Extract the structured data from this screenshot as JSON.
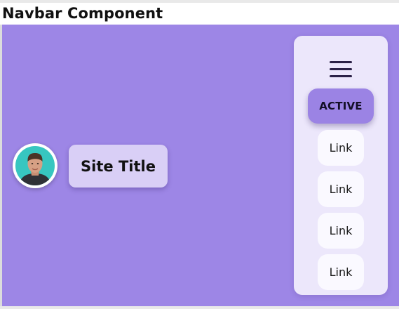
{
  "page": {
    "heading": "Navbar Component"
  },
  "navbar": {
    "site_title": "Site Title",
    "avatar_icon": "user-avatar-icon",
    "menu_icon": "hamburger-menu-icon",
    "active_link": "ACTIVE",
    "links": [
      {
        "label": "Link"
      },
      {
        "label": "Link"
      },
      {
        "label": "Link"
      },
      {
        "label": "Link"
      }
    ]
  },
  "colors": {
    "stage_background": "#9d86e6",
    "panel_background": "#ece7fb",
    "active_background": "#9b83e4",
    "site_title_background": "#d9cff6",
    "link_background": "#faf9ff",
    "avatar_background": "#37c6c0"
  }
}
